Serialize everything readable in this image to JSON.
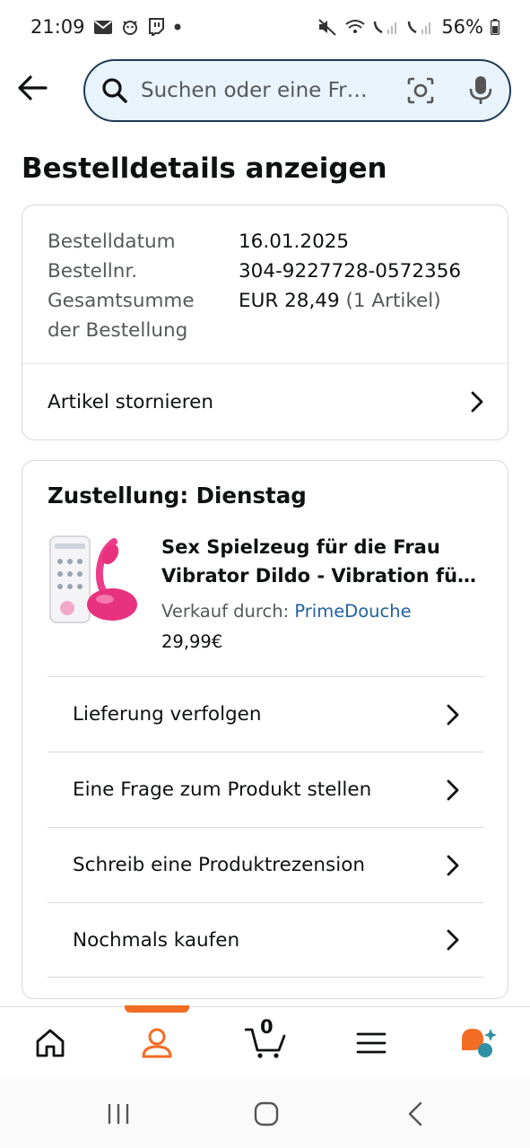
{
  "status_bar": {
    "time": "21:09",
    "battery": "56%",
    "left_icons": [
      "mail-icon",
      "dog-icon",
      "twitch-icon",
      "dot-icon"
    ],
    "right_icons": [
      "mute-icon",
      "wifi-call-icon",
      "sim1-signal-icon",
      "sim2-signal-icon",
      "battery-icon"
    ]
  },
  "search": {
    "placeholder": "Suchen oder eine Fr…",
    "icons": [
      "search-icon",
      "camera-lens-icon",
      "microphone-icon"
    ]
  },
  "page": {
    "title": "Bestelldetails anzeigen"
  },
  "order_details": {
    "rows": [
      {
        "label": "Bestelldatum",
        "value": "16.01.2025"
      },
      {
        "label": "Bestellnr.",
        "value": "304-9227728-0572356"
      },
      {
        "label": "Gesamtsumme",
        "value": "EUR 28,49",
        "extra": "(1 Artikel)"
      },
      {
        "label": "der Bestellung",
        "value": ""
      }
    ],
    "cancel_label": "Artikel stornieren"
  },
  "delivery": {
    "title": "Zustellung: Dienstag",
    "product": {
      "title_line1": "Sex Spielzeug für die Frau",
      "title_line2": "Vibrator Dildo - Vibration fü…",
      "seller_prefix": "Verkauf durch:",
      "seller_name": "PrimeDouche",
      "price": "29,99€"
    },
    "actions": [
      {
        "label": "Lieferung verfolgen"
      },
      {
        "label": "Eine Frage zum Produkt stellen"
      },
      {
        "label": "Schreib eine Produktrezension"
      },
      {
        "label": "Nochmals kaufen"
      }
    ]
  },
  "bottom_nav": {
    "items": [
      "home-icon",
      "account-icon",
      "cart-icon",
      "menu-icon",
      "rufus-icon"
    ],
    "active": "account-icon",
    "cart_count": "0",
    "accent": "#f26c23"
  },
  "system_nav": [
    "recents-icon",
    "home-button-icon",
    "back-button-icon"
  ]
}
